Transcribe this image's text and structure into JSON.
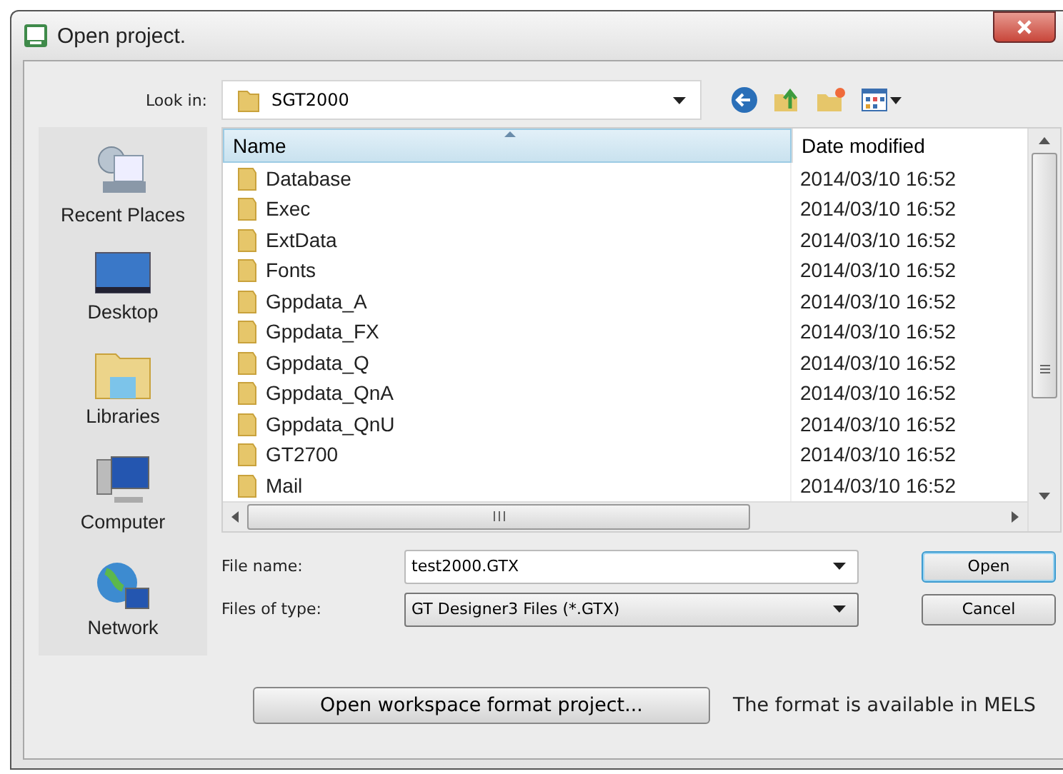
{
  "window": {
    "title": "Open project."
  },
  "look_in": {
    "label": "Look in:",
    "value": "SGT2000"
  },
  "places": [
    {
      "label": "Recent Places",
      "kind": "recent"
    },
    {
      "label": "Desktop",
      "kind": "desktop"
    },
    {
      "label": "Libraries",
      "kind": "libraries"
    },
    {
      "label": "Computer",
      "kind": "computer"
    },
    {
      "label": "Network",
      "kind": "network"
    }
  ],
  "table": {
    "columns": [
      "Name",
      "Date modified"
    ],
    "rows": [
      {
        "name": "Database",
        "date": "2014/03/10 16:52"
      },
      {
        "name": "Exec",
        "date": "2014/03/10 16:52"
      },
      {
        "name": "ExtData",
        "date": "2014/03/10 16:52"
      },
      {
        "name": "Fonts",
        "date": "2014/03/10 16:52"
      },
      {
        "name": "Gppdata_A",
        "date": "2014/03/10 16:52"
      },
      {
        "name": "Gppdata_FX",
        "date": "2014/03/10 16:52"
      },
      {
        "name": "Gppdata_Q",
        "date": "2014/03/10 16:52"
      },
      {
        "name": "Gppdata_QnA",
        "date": "2014/03/10 16:52"
      },
      {
        "name": "Gppdata_QnU",
        "date": "2014/03/10 16:52"
      },
      {
        "name": "GT2700",
        "date": "2014/03/10 16:52"
      },
      {
        "name": "Mail",
        "date": "2014/03/10 16:52"
      }
    ]
  },
  "file_name": {
    "label": "File name:",
    "value": "test2000.GTX"
  },
  "file_type": {
    "label": "Files of type:",
    "value": "GT Designer3 Files (*.GTX)"
  },
  "buttons": [
    "Open",
    "Cancel"
  ],
  "workspace_button": "Open workspace format project...",
  "note": "The format is available in MELS"
}
